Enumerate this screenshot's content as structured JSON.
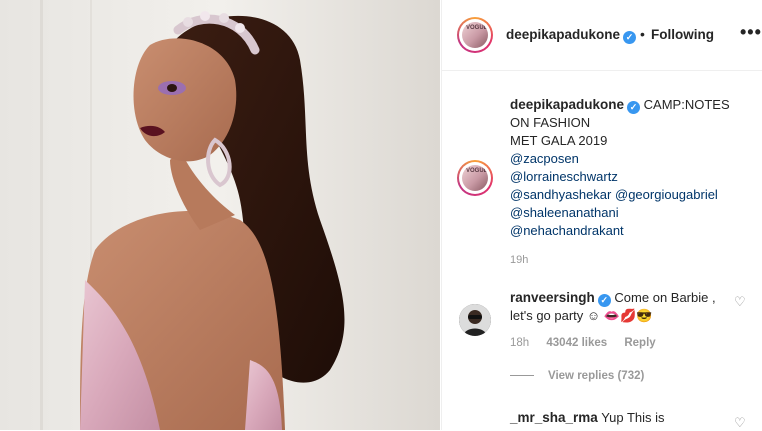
{
  "post": {
    "username": "deepikapadukone",
    "following_label": "Following",
    "more_label": "•••",
    "dot": "•",
    "verified_glyph": "✓"
  },
  "avatar": {
    "logo_text": "VOGUE"
  },
  "caption": {
    "username": "deepikapadukone",
    "line1": "CAMP:NOTES",
    "line2": "ON FASHION",
    "line3": "MET GALA 2019",
    "mentions": [
      "@zacposen",
      "@lorraineschwartz"
    ],
    "mention_row_a": "@sandhyashekar",
    "mention_row_b": "@georgiougabriel",
    "mentions_after": [
      "@shaleenanathani",
      "@nehachandrakant"
    ],
    "time": "19h"
  },
  "comments": [
    {
      "username": "ranveersingh",
      "text": "Come on Barbie , let's go party ☺ 👄💋😎",
      "time": "18h",
      "likes": "43042 likes",
      "reply": "Reply",
      "view_replies": "View replies (732)"
    },
    {
      "username": "_mr_sha_rma",
      "text": "Yup This is"
    }
  ],
  "icons": {
    "heart": "♡"
  },
  "colors": {
    "link": "#003569",
    "verified": "#3897f0",
    "muted": "#999999"
  }
}
